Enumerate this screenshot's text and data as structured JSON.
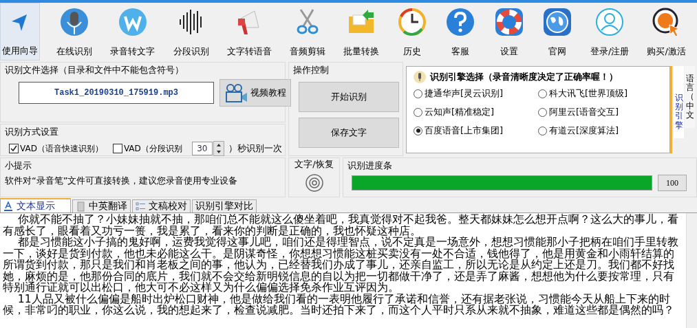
{
  "toolbar": {
    "items": [
      {
        "label": "使用向导",
        "selected": true
      },
      {
        "label": "在线识别",
        "selected": false
      },
      {
        "label": "录音转文字",
        "selected": false
      },
      {
        "label": "分段识别",
        "selected": false
      },
      {
        "label": "文字转语音",
        "selected": false
      },
      {
        "label": "音频剪辑",
        "selected": false
      },
      {
        "label": "批量转换",
        "selected": false
      },
      {
        "label": "历史",
        "selected": false
      },
      {
        "label": "客服",
        "selected": false
      },
      {
        "label": "设置",
        "selected": false
      },
      {
        "label": "官网",
        "selected": false
      },
      {
        "label": "登录/注册",
        "selected": false
      },
      {
        "label": "购买/激活",
        "selected": false
      }
    ]
  },
  "file_group": {
    "title": "识别文件选择（目录和文件中不能包含符号）",
    "file_name": "Task1_20190310_175919.mp3",
    "tutorial_button": "视频教程"
  },
  "mode_group": {
    "title": "识别方式设置",
    "options": [
      {
        "label": "VAD（语音快速识别）",
        "checked": true
      },
      {
        "label": "VAD（分段识别",
        "checked": false
      }
    ],
    "interval": "30",
    "interval_suffix": "）秒识别一次"
  },
  "tips": {
    "title": "小提示",
    "text": "软件对“录音笔”文件可直接转换，建议您录音使用专业设备"
  },
  "operations": {
    "title": "操作控制",
    "buttons": [
      "开始识别",
      "保存文字"
    ]
  },
  "restore": {
    "title": "文字/恢复"
  },
  "progress": {
    "title": "识别进度条",
    "level": 1,
    "reading": "100"
  },
  "engine": {
    "title": "识别引擎选择（录音清晰度决定了正确率喔！）",
    "options": [
      {
        "label": "捷通华声[灵云识别]",
        "selected": false
      },
      {
        "label": "科大讯飞[世界顶级]",
        "selected": false
      },
      {
        "label": "云知声[精准稳定]",
        "selected": false
      },
      {
        "label": "阿里云[语音交互]",
        "selected": false
      },
      {
        "label": "百度语音[上市集团]",
        "selected": true
      },
      {
        "label": "有道云[深度算法]",
        "selected": false
      }
    ],
    "side_tabs": [
      {
        "label": "识别引擎",
        "selected": true
      },
      {
        "label": "语言（中文",
        "selected": false
      }
    ]
  },
  "tabs": [
    {
      "label": "文本显示",
      "selected": true
    },
    {
      "label": "中英翻译",
      "selected": false
    },
    {
      "label": "文稿校对",
      "selected": false
    },
    {
      "label": "识别引擎对比",
      "selected": false
    }
  ],
  "document": {
    "paragraphs": [
      "你就不能不抽了？小妹妹抽就不抽，那咱们总不能就这么傻坐着吧，我真觉得对不起我爸。整天都妹妹怎么想开点啊？这么大的事儿，看有感长了，眼看着又功亏一篑，我是累了，看来你的判断是正确的，我也怀疑这种店。",
      "都是习惯能这小子搞的鬼好啊，运费我觉得这事儿吧，咱们还是得理智点，说不定真是一场意外，想想习惯能那小子把柄在咱们手里转教一下，谈好是货到付款，他也未必能这么干。是阴谋奇怪，你想想习惯能这桩买卖没有一处不合适，钱他得了，他是用黄金和小雨轩结算的所谓货到付款，那只是我们和肖老板之间的事，他认为，已经替我们办成了事儿，还亲自监工，所以无论是从约定上还是刀。我们都不好找她，麻烦的是，他那份合同的底片，我们就不会交给新明锐信息的自以为把一切都做干净了，还是弄了麻酱，想想他为什么要按常理，只有特别通行证就可以出松口，他大可不必这样又为什么偏偏选择免杀作业互评因为。",
      "11人品又被什么偏偏是船时出炉松口财神，他是做给我们看的一表明他履行了承诺和信誉，还有据老张说，习惯能今天从船上下来的时候，非常叼的职业，你这么说，我的想起来了，检查说减肥。当时还拍下来了，而这个人平时只系从来就不抽象，难道这些都是偶然的吗？"
    ]
  }
}
